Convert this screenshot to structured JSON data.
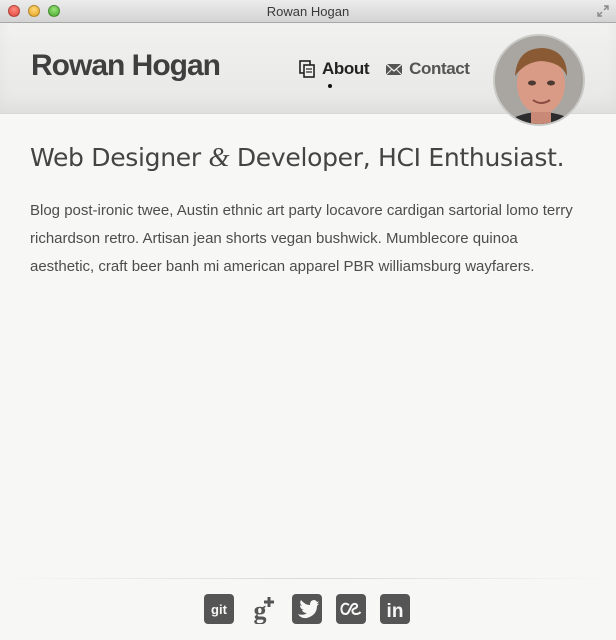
{
  "window": {
    "title": "Rowan Hogan"
  },
  "header": {
    "brand": "Rowan Hogan",
    "nav": [
      {
        "label": "About",
        "icon": "documents-icon",
        "active": true
      },
      {
        "label": "Contact",
        "icon": "envelope-icon",
        "active": false
      }
    ],
    "avatar": "profile-photo"
  },
  "main": {
    "headline_before": "Web Designer ",
    "headline_amp": "&",
    "headline_after": " Developer, HCI Enthusiast.",
    "intro": "Blog post-ironic twee, Austin ethnic art party locavore cardigan sartorial lomo terry richardson retro. Artisan jean shorts vegan bushwick. Mumblecore quinoa aesthetic, craft beer banh mi american apparel PBR williamsburg wayfarers."
  },
  "footer": {
    "social": [
      {
        "name": "github",
        "label": "git"
      },
      {
        "name": "google-plus",
        "label": "g+"
      },
      {
        "name": "twitter",
        "label": ""
      },
      {
        "name": "lastfm",
        "label": ""
      },
      {
        "name": "linkedin",
        "label": "in"
      }
    ]
  },
  "colors": {
    "icon": "#555555",
    "text": "#4a4a4a",
    "background": "#f7f7f6"
  }
}
